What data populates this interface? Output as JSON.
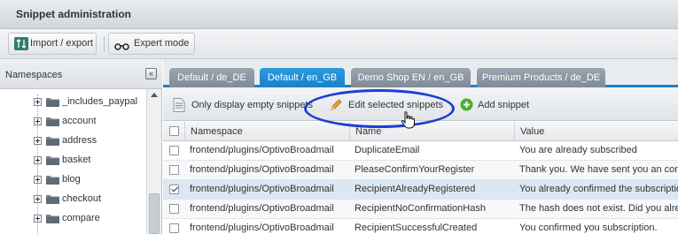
{
  "window": {
    "title": "Snippet administration"
  },
  "toolbar": {
    "import_export": {
      "label": "Import / export",
      "icon": "import-export-icon"
    },
    "expert_mode": {
      "label": "Expert mode",
      "icon": "glasses-icon"
    }
  },
  "sidebar": {
    "title": "Namespaces",
    "collapse_symbol": "«",
    "items": [
      {
        "label": "_includes_paypal"
      },
      {
        "label": "account"
      },
      {
        "label": "address"
      },
      {
        "label": "basket"
      },
      {
        "label": "blog"
      },
      {
        "label": "checkout"
      },
      {
        "label": "compare"
      }
    ]
  },
  "tabs": [
    {
      "label": "Default / de_DE",
      "active": false
    },
    {
      "label": "Default / en_GB",
      "active": true
    },
    {
      "label": "Demo Shop EN / en_GB",
      "active": false
    },
    {
      "label": "Premium Products / de_DE",
      "active": false
    }
  ],
  "grid_toolbar": {
    "empty_only": "Only display empty snippets",
    "edit_selected": "Edit selected snippets",
    "add": "Add snippet"
  },
  "grid": {
    "columns": [
      "Namespace",
      "Name",
      "Value"
    ],
    "rows": [
      {
        "namespace": "frontend/plugins/OptivoBroadmail",
        "name": "DuplicateEmail",
        "value": "You are already subscribed",
        "checked": false
      },
      {
        "namespace": "frontend/plugins/OptivoBroadmail",
        "name": "PleaseConfirmYourRegister",
        "value": "Thank you. We have sent you an con",
        "checked": false
      },
      {
        "namespace": "frontend/plugins/OptivoBroadmail",
        "name": "RecipientAlreadyRegistered",
        "value": "You already confirmed the subscriptio",
        "checked": true
      },
      {
        "namespace": "frontend/plugins/OptivoBroadmail",
        "name": "RecipientNoConfirmationHash",
        "value": "The hash does not exist. Did you alre",
        "checked": false
      },
      {
        "namespace": "frontend/plugins/OptivoBroadmail",
        "name": "RecipientSuccessfulCreated",
        "value": "You confirmed you subscription.",
        "checked": false
      }
    ]
  },
  "colors": {
    "active_tab": "#1a82c8",
    "inactive_tab": "#8a96a2",
    "annotation": "#1d3fd1",
    "add_icon": "#4caf2a"
  }
}
